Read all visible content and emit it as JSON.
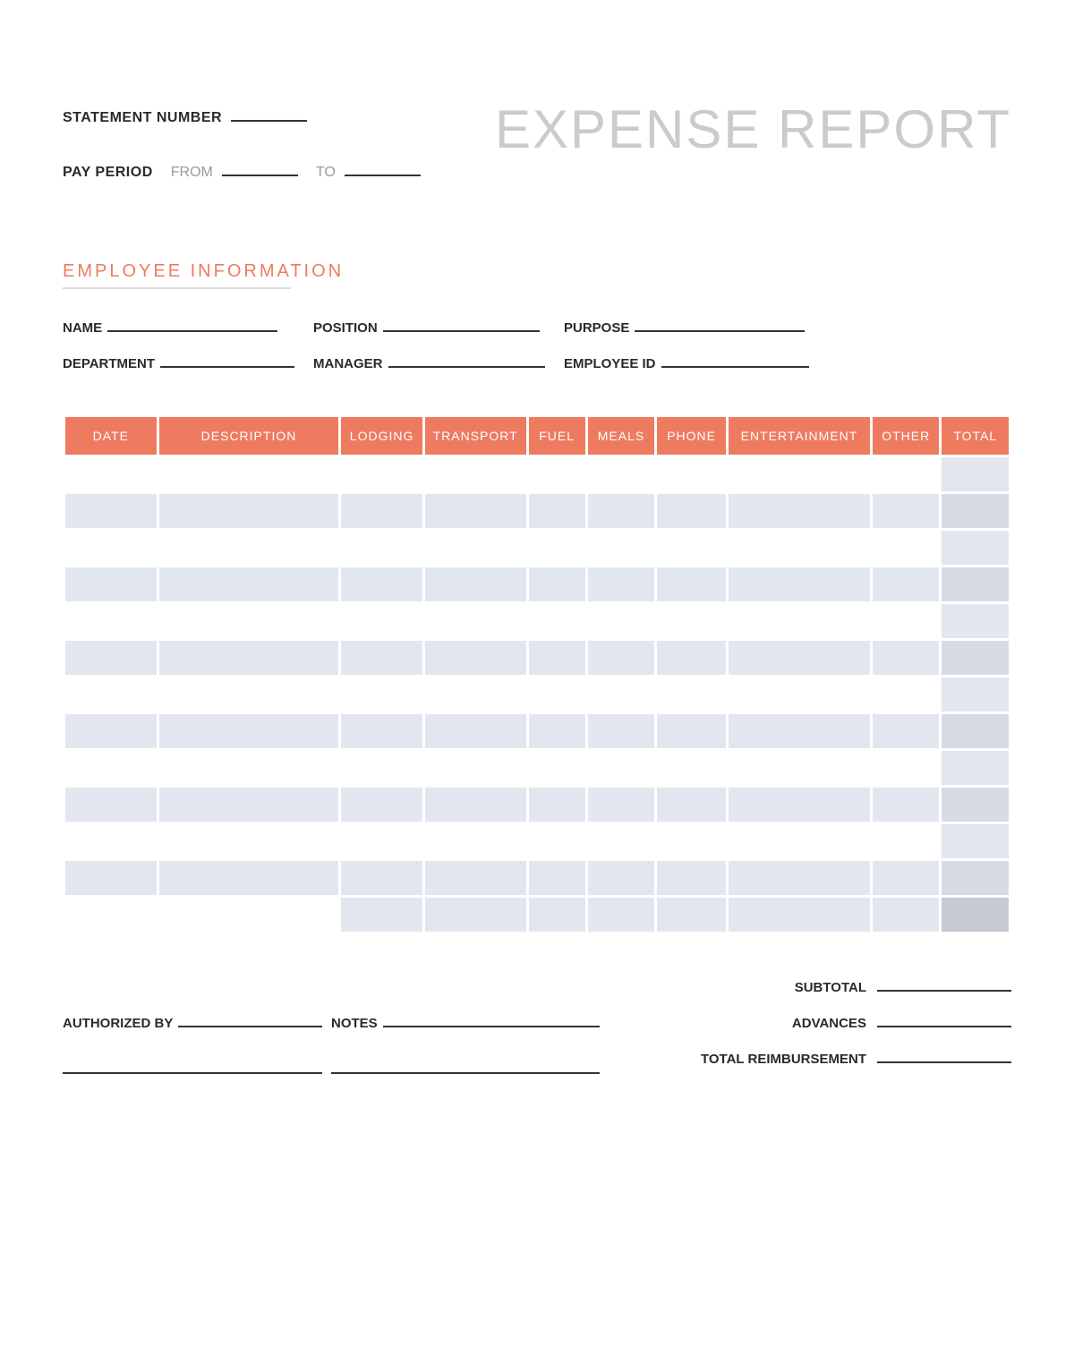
{
  "header": {
    "statement_number_label": "STATEMENT NUMBER",
    "pay_period_label": "PAY PERIOD",
    "from_label": "FROM",
    "to_label": "TO",
    "title": "EXPENSE REPORT"
  },
  "employee_section": {
    "heading": "EMPLOYEE INFORMATION",
    "fields": {
      "name": "NAME",
      "position": "POSITION",
      "purpose": "PURPOSE",
      "department": "DEPARTMENT",
      "manager": "MANAGER",
      "employee_id": "EMPLOYEE ID"
    }
  },
  "table": {
    "headers": {
      "date": "DATE",
      "description": "DESCRIPTION",
      "lodging": "LODGING",
      "transport": "TRANSPORT",
      "fuel": "FUEL",
      "meals": "MEALS",
      "phone": "PHONE",
      "entertainment": "ENTERTAINMENT",
      "other": "OTHER",
      "total": "TOTAL"
    },
    "row_count": 12
  },
  "footer": {
    "authorized_by": "AUTHORIZED BY",
    "notes": "NOTES",
    "subtotal": "SUBTOTAL",
    "advances": "ADVANCES",
    "total_reimbursement": "TOTAL REIMBURSEMENT"
  }
}
